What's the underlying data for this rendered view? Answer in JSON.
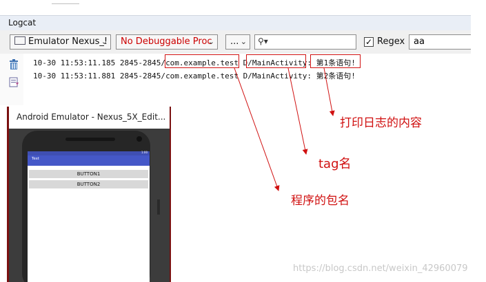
{
  "panel": {
    "title": "Logcat"
  },
  "toolbar": {
    "device_label": "Emulator Nexus_!",
    "process_label": "No Debuggable Proc",
    "level_label": "...",
    "search_placeholder": "",
    "regex_label": "Regex",
    "regex_checked": true,
    "filter_value": "aa"
  },
  "log": {
    "lines": [
      {
        "prefix": "10-30 11:53:11.185 2845-2845/",
        "package": "com.example.test",
        "level": " D/",
        "tag": "MainActivity",
        "sep": ": ",
        "message": "第1条语句!"
      },
      {
        "prefix": "10-30 11:53:11.881 2845-2845/",
        "package": "com.example.test",
        "level": " D/",
        "tag": "MainActivity",
        "sep": ": ",
        "message": "第2条语句!"
      }
    ]
  },
  "annotations": {
    "content": "打印日志的内容",
    "tag": "tag名",
    "package": "程序的包名"
  },
  "emulator": {
    "title": "Android Emulator - Nexus_5X_Edit...",
    "app_title": "Test",
    "status_time": "1:00",
    "buttons": [
      "BUTTON1",
      "BUTTON2"
    ]
  },
  "watermark": "https://blog.csdn.net/weixin_42960079",
  "colors": {
    "annotation": "#d01010",
    "app_bar": "#4558c8",
    "process_text": "#cc0000"
  }
}
